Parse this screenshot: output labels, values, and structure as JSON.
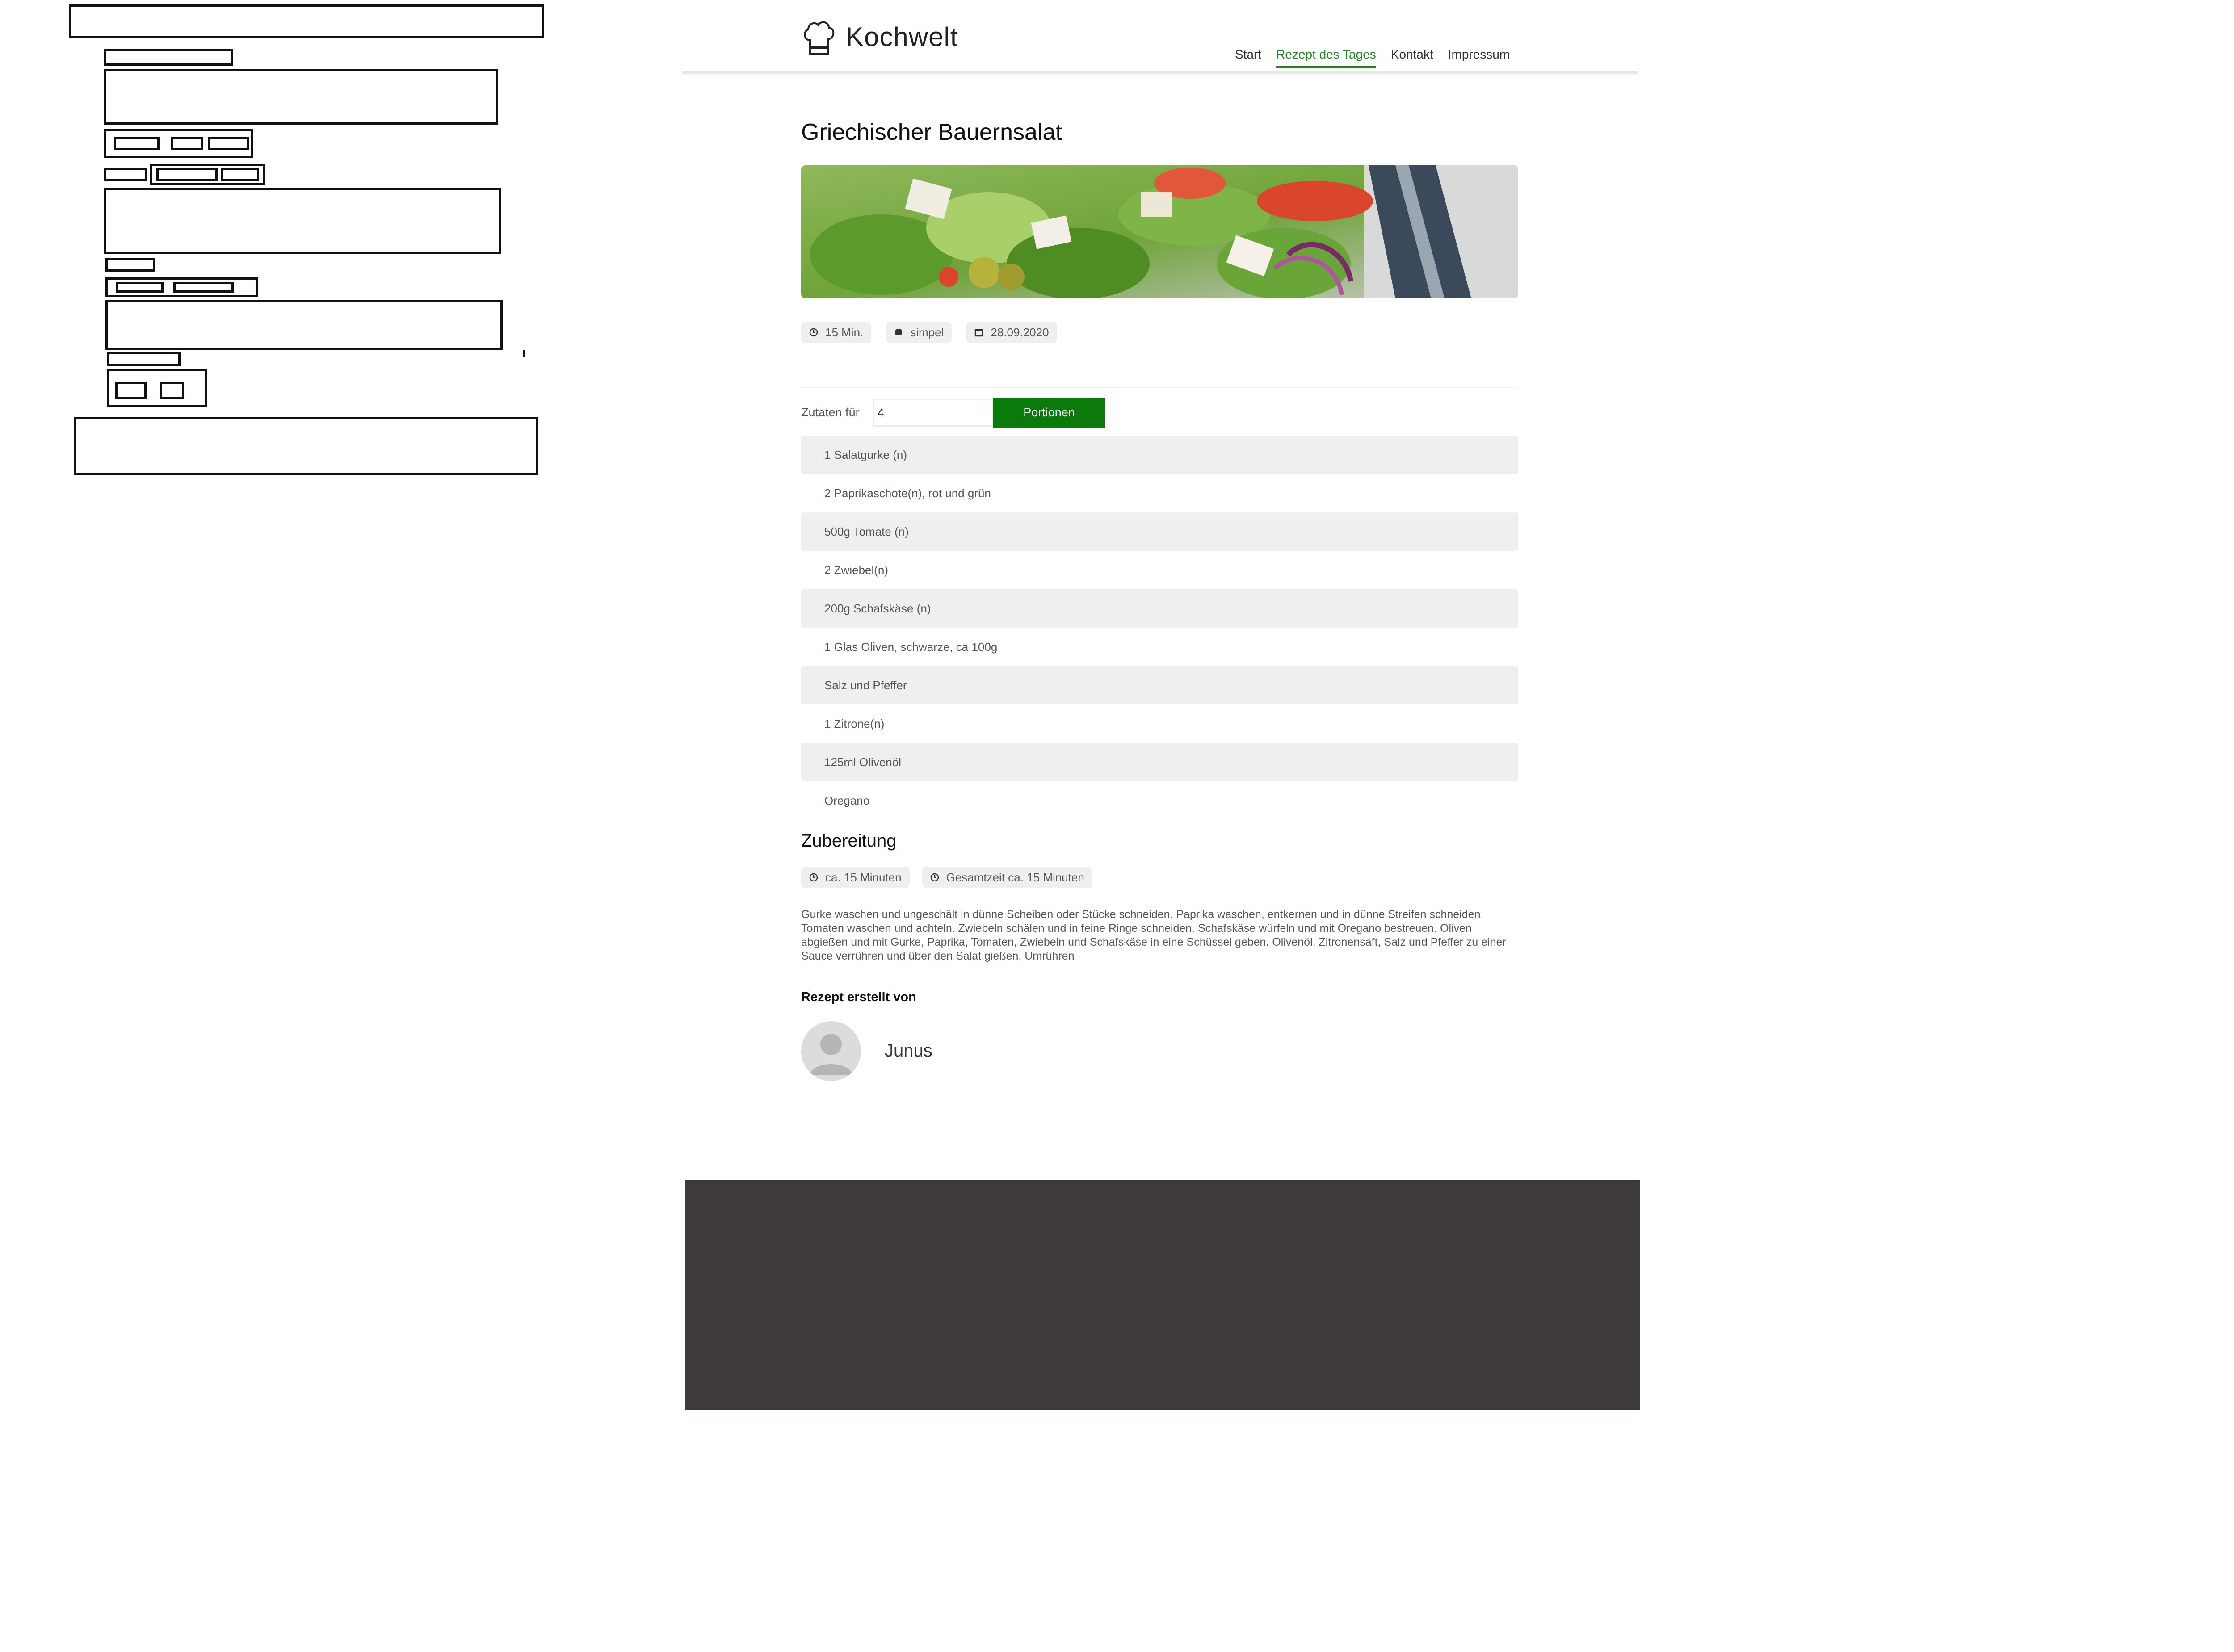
{
  "brand": {
    "name": "Kochwelt",
    "logo_icon": "chef-hat-icon"
  },
  "nav": [
    {
      "label": "Start",
      "active": false
    },
    {
      "label": "Rezept des Tages",
      "active": true
    },
    {
      "label": "Kontakt",
      "active": false
    },
    {
      "label": "Impressum",
      "active": false
    }
  ],
  "recipe": {
    "title": "Griechischer Bauernsalat",
    "meta": [
      {
        "icon": "clock-icon",
        "text": "15 Min."
      },
      {
        "icon": "difficulty-icon",
        "text": "simpel"
      },
      {
        "icon": "calendar-icon",
        "text": "28.09.2020"
      }
    ],
    "servings_label": "Zutaten für",
    "servings_value": "4",
    "servings_button": "Portionen",
    "ingredients": [
      "1 Salatgurke (n)",
      "2 Paprikaschote(n), rot und grün",
      "500g Tomate (n)",
      "2 Zwiebel(n)",
      "200g Schafskäse (n)",
      "1 Glas Oliven, schwarze, ca 100g",
      "Salz und Pfeffer",
      "1 Zitrone(n)",
      "125ml Olivenöl",
      "Oregano"
    ],
    "preparation_heading": "Zubereitung",
    "prep_meta": [
      {
        "icon": "clock-icon",
        "text": "ca. 15 Minuten"
      },
      {
        "icon": "clock-icon",
        "text": "Gesamtzeit ca. 15 Minuten"
      }
    ],
    "preparation_text": "Gurke waschen und ungeschält in dünne Scheiben oder Stücke schneiden. Paprika waschen, entkernen und in dünne Streifen schneiden. Tomaten waschen und achteln. Zwiebeln schälen und in feine Ringe schneiden. Schafskäse würfeln und mit Oregano bestreuen. Oliven abgießen und mit Gurke, Paprika, Tomaten, Zwiebeln und Schafskäse in eine Schüssel geben. Olivenöl, Zitronensaft, Salz und Pfeffer zu einer Sauce verrühren und über den Salat gießen. Umrühren",
    "author_heading": "Rezept erstellt von",
    "author_name": "Junus"
  },
  "colors": {
    "accent": "#0a7a0a",
    "nav_active": "#1f8a1f",
    "footer": "#3e3b3a",
    "row_shade": "#efefef"
  }
}
